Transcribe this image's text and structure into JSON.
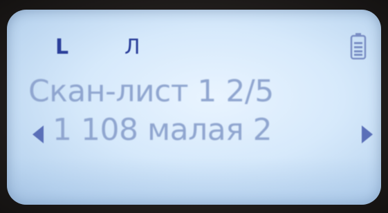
{
  "indicators": {
    "mode_l": "L",
    "mode_pulse": "Л",
    "battery_icon": "battery-icon"
  },
  "screen": {
    "line1": "Скан-лист 1 2/5",
    "line2": "1 108 малая 2",
    "left_arrow_icon": "arrow-left-icon",
    "right_arrow_icon": "arrow-right-icon"
  },
  "colors": {
    "lcd_background": "#d6e9fb",
    "text_primary": "#8fa5cf",
    "indicator": "#2b3f9a"
  }
}
